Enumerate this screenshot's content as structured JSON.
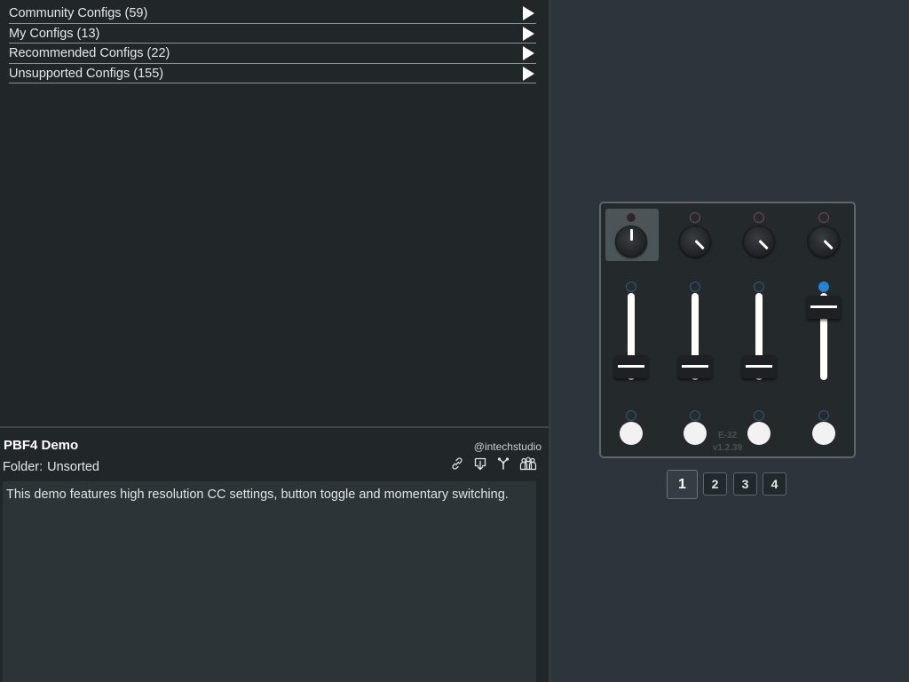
{
  "config_list": [
    {
      "label": "Community Configs (59)"
    },
    {
      "label": "My Configs (13)"
    },
    {
      "label": "Recommended Configs (22)"
    },
    {
      "label": "Unsupported Configs (155)"
    }
  ],
  "detail": {
    "title": "PBF4 Demo",
    "author": "@intechstudio",
    "folder_label": "Folder:",
    "folder_value": "Unsorted",
    "description": "This demo features high resolution CC settings, button toggle and momentary switching.",
    "actions": [
      "link-icon",
      "download-icon",
      "branch-icon",
      "community-icon"
    ]
  },
  "device": {
    "model": "E-32",
    "version": "v1.2.39",
    "led_on_color": "#1e87d6",
    "faders_level": [
      0.1,
      0.1,
      0.1,
      0.9
    ]
  },
  "pagination": {
    "pages": [
      "1",
      "2",
      "3",
      "4"
    ],
    "active": "1"
  }
}
